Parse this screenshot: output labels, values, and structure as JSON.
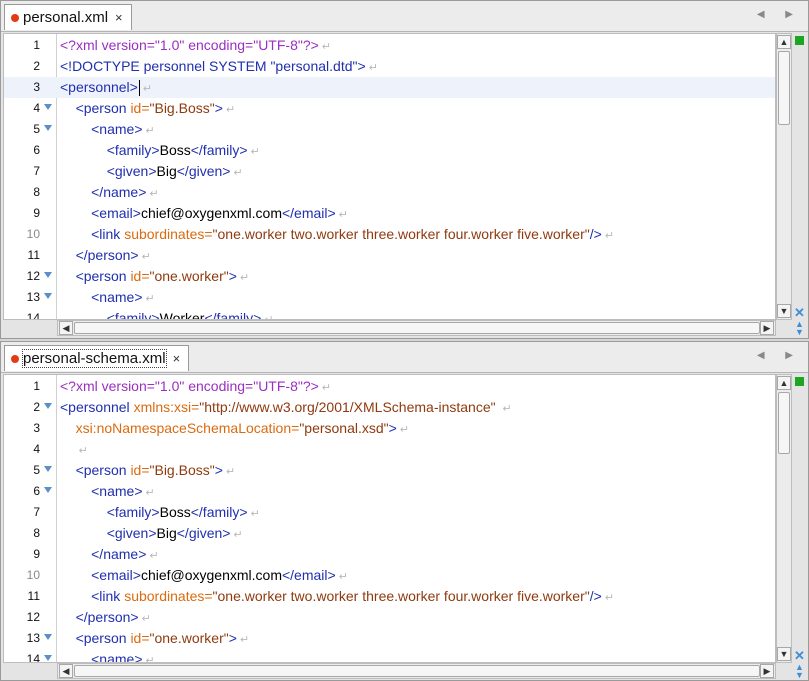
{
  "panes": [
    {
      "tab": {
        "title": "personal.xml",
        "close_label": "×"
      },
      "nav_arrows": "◀ ▶",
      "lines": [
        {
          "num": "1",
          "fold": false,
          "segments": [
            {
              "c": "pi",
              "t": "<?xml version=\"1.0\" encoding=\"UTF-8\"?>"
            }
          ]
        },
        {
          "num": "2",
          "fold": false,
          "segments": [
            {
              "c": "tg",
              "t": "<!DOCTYPE personnel SYSTEM \"personal.dtd\">"
            }
          ]
        },
        {
          "num": "3",
          "fold": false,
          "current": true,
          "segments": [
            {
              "c": "tg",
              "t": "<personnel>"
            }
          ]
        },
        {
          "num": "4",
          "fold": true,
          "segments": [
            {
              "c": "tx",
              "t": "    "
            },
            {
              "c": "tg",
              "t": "<person "
            },
            {
              "c": "an",
              "t": "id="
            },
            {
              "c": "av",
              "t": "\"Big.Boss\""
            },
            {
              "c": "tg",
              "t": ">"
            }
          ]
        },
        {
          "num": "5",
          "fold": true,
          "segments": [
            {
              "c": "tx",
              "t": "        "
            },
            {
              "c": "tg",
              "t": "<name>"
            }
          ]
        },
        {
          "num": "6",
          "fold": false,
          "segments": [
            {
              "c": "tx",
              "t": "            "
            },
            {
              "c": "tg",
              "t": "<family>"
            },
            {
              "c": "tx",
              "t": "Boss"
            },
            {
              "c": "tg",
              "t": "</family>"
            }
          ]
        },
        {
          "num": "7",
          "fold": false,
          "segments": [
            {
              "c": "tx",
              "t": "            "
            },
            {
              "c": "tg",
              "t": "<given>"
            },
            {
              "c": "tx",
              "t": "Big"
            },
            {
              "c": "tg",
              "t": "</given>"
            }
          ]
        },
        {
          "num": "8",
          "fold": false,
          "segments": [
            {
              "c": "tx",
              "t": "        "
            },
            {
              "c": "tg",
              "t": "</name>"
            }
          ]
        },
        {
          "num": "9",
          "fold": false,
          "segments": [
            {
              "c": "tx",
              "t": "        "
            },
            {
              "c": "tg",
              "t": "<email>"
            },
            {
              "c": "tx",
              "t": "chief@oxygenxml.com"
            },
            {
              "c": "tg",
              "t": "</email>"
            }
          ]
        },
        {
          "num": "10",
          "fold": false,
          "gray": true,
          "segments": [
            {
              "c": "tx",
              "t": "        "
            },
            {
              "c": "tg",
              "t": "<link "
            },
            {
              "c": "an",
              "t": "subordinates="
            },
            {
              "c": "av",
              "t": "\"one.worker two.worker three.worker four.worker five.worker\""
            },
            {
              "c": "tg",
              "t": "/>"
            }
          ]
        },
        {
          "num": "11",
          "fold": false,
          "segments": [
            {
              "c": "tx",
              "t": "    "
            },
            {
              "c": "tg",
              "t": "</person>"
            }
          ]
        },
        {
          "num": "12",
          "fold": true,
          "segments": [
            {
              "c": "tx",
              "t": "    "
            },
            {
              "c": "tg",
              "t": "<person "
            },
            {
              "c": "an",
              "t": "id="
            },
            {
              "c": "av",
              "t": "\"one.worker\""
            },
            {
              "c": "tg",
              "t": ">"
            }
          ]
        },
        {
          "num": "13",
          "fold": true,
          "segments": [
            {
              "c": "tx",
              "t": "        "
            },
            {
              "c": "tg",
              "t": "<name>"
            }
          ]
        },
        {
          "num": "14",
          "fold": false,
          "segments": [
            {
              "c": "tx",
              "t": "            "
            },
            {
              "c": "tg",
              "t": "<family>"
            },
            {
              "c": "tx",
              "t": "Worker"
            },
            {
              "c": "tg",
              "t": "</family>"
            }
          ]
        }
      ]
    },
    {
      "tab": {
        "title": "personal-schema.xml",
        "close_label": "×"
      },
      "nav_arrows": "◀ ▶",
      "lines": [
        {
          "num": "1",
          "fold": false,
          "segments": [
            {
              "c": "pi",
              "t": "<?xml version=\"1.0\" encoding=\"UTF-8\"?>"
            }
          ]
        },
        {
          "num": "2",
          "fold": true,
          "segments": [
            {
              "c": "tg",
              "t": "<personnel "
            },
            {
              "c": "an",
              "t": "xmlns:xsi="
            },
            {
              "c": "av",
              "t": "\"http://www.w3.org/2001/XMLSchema-instance\" "
            }
          ]
        },
        {
          "num": "3",
          "fold": false,
          "segments": [
            {
              "c": "tx",
              "t": "    "
            },
            {
              "c": "an",
              "t": "xsi:noNamespaceSchemaLocation="
            },
            {
              "c": "av",
              "t": "\"personal.xsd\""
            },
            {
              "c": "tg",
              "t": ">"
            }
          ]
        },
        {
          "num": "4",
          "fold": false,
          "segments": [
            {
              "c": "tx",
              "t": "    "
            }
          ]
        },
        {
          "num": "5",
          "fold": true,
          "segments": [
            {
              "c": "tx",
              "t": "    "
            },
            {
              "c": "tg",
              "t": "<person "
            },
            {
              "c": "an",
              "t": "id="
            },
            {
              "c": "av",
              "t": "\"Big.Boss\""
            },
            {
              "c": "tg",
              "t": ">"
            }
          ]
        },
        {
          "num": "6",
          "fold": true,
          "segments": [
            {
              "c": "tx",
              "t": "        "
            },
            {
              "c": "tg",
              "t": "<name>"
            }
          ]
        },
        {
          "num": "7",
          "fold": false,
          "segments": [
            {
              "c": "tx",
              "t": "            "
            },
            {
              "c": "tg",
              "t": "<family>"
            },
            {
              "c": "tx",
              "t": "Boss"
            },
            {
              "c": "tg",
              "t": "</family>"
            }
          ]
        },
        {
          "num": "8",
          "fold": false,
          "segments": [
            {
              "c": "tx",
              "t": "            "
            },
            {
              "c": "tg",
              "t": "<given>"
            },
            {
              "c": "tx",
              "t": "Big"
            },
            {
              "c": "tg",
              "t": "</given>"
            }
          ]
        },
        {
          "num": "9",
          "fold": false,
          "segments": [
            {
              "c": "tx",
              "t": "        "
            },
            {
              "c": "tg",
              "t": "</name>"
            }
          ]
        },
        {
          "num": "10",
          "fold": false,
          "gray": true,
          "segments": [
            {
              "c": "tx",
              "t": "        "
            },
            {
              "c": "tg",
              "t": "<email>"
            },
            {
              "c": "tx",
              "t": "chief@oxygenxml.com"
            },
            {
              "c": "tg",
              "t": "</email>"
            }
          ]
        },
        {
          "num": "11",
          "fold": false,
          "segments": [
            {
              "c": "tx",
              "t": "        "
            },
            {
              "c": "tg",
              "t": "<link "
            },
            {
              "c": "an",
              "t": "subordinates="
            },
            {
              "c": "av",
              "t": "\"one.worker two.worker three.worker four.worker five.worker\""
            },
            {
              "c": "tg",
              "t": "/>"
            }
          ]
        },
        {
          "num": "12",
          "fold": false,
          "segments": [
            {
              "c": "tx",
              "t": "    "
            },
            {
              "c": "tg",
              "t": "</person>"
            }
          ]
        },
        {
          "num": "13",
          "fold": true,
          "segments": [
            {
              "c": "tx",
              "t": "    "
            },
            {
              "c": "tg",
              "t": "<person "
            },
            {
              "c": "an",
              "t": "id="
            },
            {
              "c": "av",
              "t": "\"one.worker\""
            },
            {
              "c": "tg",
              "t": ">"
            }
          ]
        },
        {
          "num": "14",
          "fold": true,
          "segments": [
            {
              "c": "tx",
              "t": "        "
            },
            {
              "c": "tg",
              "t": "<name>"
            }
          ]
        }
      ]
    }
  ],
  "eol_marker": "↵",
  "scroll": {
    "up": "▲",
    "down": "▼",
    "left": "◀",
    "right": "▶",
    "grip": "|||"
  },
  "colors": {
    "status_ok": "#1ca620",
    "nav_blue": "#3e8ed6",
    "modified_dot": "#e23b14"
  }
}
